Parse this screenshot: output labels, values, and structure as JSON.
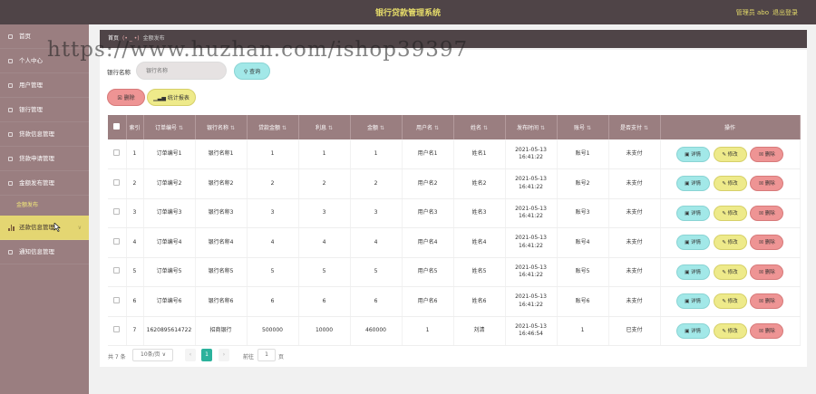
{
  "header": {
    "title": "银行贷款管理系统",
    "admin": "管理员 abo",
    "logout": "退出登录"
  },
  "sidebar": {
    "items": [
      {
        "label": "首页"
      },
      {
        "label": "个人中心"
      },
      {
        "label": "用户管理"
      },
      {
        "label": "银行管理"
      },
      {
        "label": "贷款信息管理"
      },
      {
        "label": "贷款申请管理"
      },
      {
        "label": "金额发布管理"
      },
      {
        "label": "金额发布",
        "sub": true
      },
      {
        "label": "还款信息管理",
        "active": true
      },
      {
        "label": "通知信息管理"
      }
    ]
  },
  "breadcrumb": {
    "home": "首页",
    "sep": "(• _ •)",
    "current": "金额发布"
  },
  "search": {
    "label": "银行名称",
    "placeholder": "银行名称",
    "query_label": "查询"
  },
  "toolbar": {
    "delete_label": "删除",
    "stat_label": "统计报表"
  },
  "table": {
    "headers": [
      "索引",
      "订单编号",
      "银行名称",
      "贷款金额",
      "利息",
      "金额",
      "用户名",
      "姓名",
      "发布时间",
      "账号",
      "是否支付",
      "操作"
    ],
    "rows": [
      {
        "idx": "1",
        "order": "订单编号1",
        "bank": "银行名称1",
        "loan": "1",
        "interest": "1",
        "amount": "1",
        "user": "用户名1",
        "name": "姓名1",
        "time": "2021-05-13 16:41:22",
        "account": "账号1",
        "paid": "未支付"
      },
      {
        "idx": "2",
        "order": "订单编号2",
        "bank": "银行名称2",
        "loan": "2",
        "interest": "2",
        "amount": "2",
        "user": "用户名2",
        "name": "姓名2",
        "time": "2021-05-13 16:41:22",
        "account": "账号2",
        "paid": "未支付"
      },
      {
        "idx": "3",
        "order": "订单编号3",
        "bank": "银行名称3",
        "loan": "3",
        "interest": "3",
        "amount": "3",
        "user": "用户名3",
        "name": "姓名3",
        "time": "2021-05-13 16:41:22",
        "account": "账号3",
        "paid": "未支付"
      },
      {
        "idx": "4",
        "order": "订单编号4",
        "bank": "银行名称4",
        "loan": "4",
        "interest": "4",
        "amount": "4",
        "user": "用户名4",
        "name": "姓名4",
        "time": "2021-05-13 16:41:22",
        "account": "账号4",
        "paid": "未支付"
      },
      {
        "idx": "5",
        "order": "订单编号5",
        "bank": "银行名称5",
        "loan": "5",
        "interest": "5",
        "amount": "5",
        "user": "用户名5",
        "name": "姓名5",
        "time": "2021-05-13 16:41:22",
        "account": "账号5",
        "paid": "未支付"
      },
      {
        "idx": "6",
        "order": "订单编号6",
        "bank": "银行名称6",
        "loan": "6",
        "interest": "6",
        "amount": "6",
        "user": "用户名6",
        "name": "姓名6",
        "time": "2021-05-13 16:41:22",
        "account": "账号6",
        "paid": "未支付"
      },
      {
        "idx": "7",
        "order": "1620895614722",
        "bank": "招商银行",
        "loan": "500000",
        "interest": "10000",
        "amount": "460000",
        "user": "1",
        "name": "刘清",
        "time": "2021-05-13 16:46:54",
        "account": "1",
        "paid": "已支付"
      }
    ],
    "actions": {
      "detail": "详情",
      "edit": "修改",
      "delete": "删除"
    }
  },
  "pagination": {
    "total": "共 7 条",
    "page_size": "10条/页",
    "current": "1",
    "goto": "前往",
    "goto_value": "1",
    "page_unit": "页"
  },
  "watermark": "https://www.huzhan.com/ishop39397",
  "colors": {
    "topbar": "#4f4447",
    "sidebar": "#9a7e80",
    "accent_yellow": "#e4d672",
    "cyan": "#a2e8e8",
    "red": "#ee9494",
    "page_active": "#2bb29c"
  }
}
